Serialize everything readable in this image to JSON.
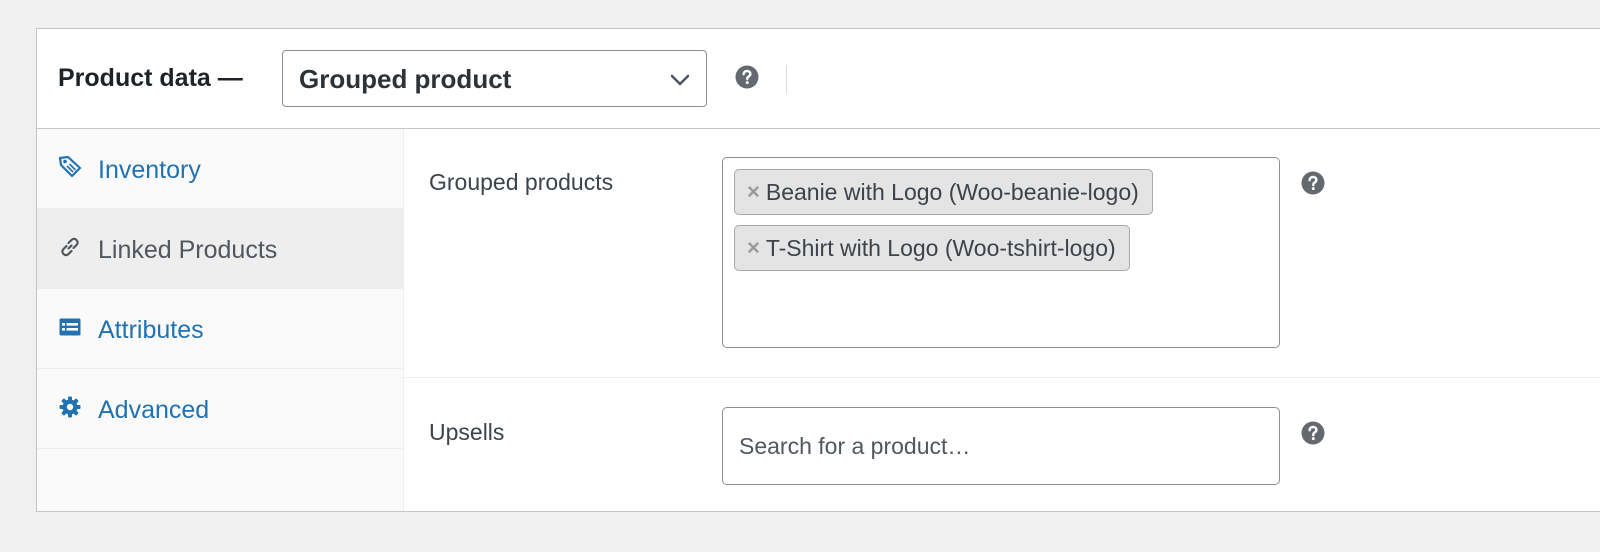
{
  "panel": {
    "title": "Product data —",
    "product_type": {
      "selected": "Grouped product",
      "help_icon": "question-circle-icon"
    }
  },
  "tabs": [
    {
      "label": "Inventory",
      "icon": "tag-icon",
      "active": false
    },
    {
      "label": "Linked Products",
      "icon": "link-icon",
      "active": true
    },
    {
      "label": "Attributes",
      "icon": "list-table-icon",
      "active": false
    },
    {
      "label": "Advanced",
      "icon": "gear-icon",
      "active": false
    }
  ],
  "fields": {
    "grouped": {
      "label": "Grouped products",
      "selected_items": [
        "Beanie with Logo (Woo-beanie-logo)",
        "T-Shirt with Logo (Woo-tshirt-logo)"
      ],
      "remove_glyph": "×"
    },
    "upsells": {
      "label": "Upsells",
      "placeholder": "Search for a product…"
    }
  },
  "colors": {
    "link": "#2271b1",
    "active_tab_text": "#50575e",
    "help_icon": "#646970",
    "border": "#8c8f94",
    "chip_bg": "#e4e4e4"
  }
}
